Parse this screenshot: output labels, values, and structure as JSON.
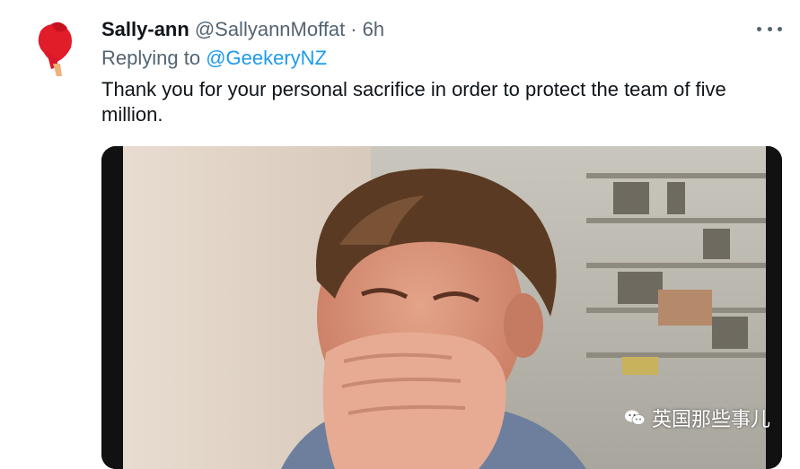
{
  "tweet": {
    "author_name": "Sally-ann",
    "author_handle": "@SallyannMoffat",
    "separator": "·",
    "time": "6h",
    "replying_prefix": "Replying to",
    "replying_to": "@GeekeryNZ",
    "text": "Thank you for your personal sacrifice in order to protect the team of five million."
  },
  "watermark": {
    "text": "英国那些事儿"
  },
  "icons": {
    "more": "more-icon",
    "watermark": "wechat-icon"
  },
  "colors": {
    "secondary_text": "#536471",
    "link": "#1d9bf0",
    "primary_text": "#0f1419"
  }
}
